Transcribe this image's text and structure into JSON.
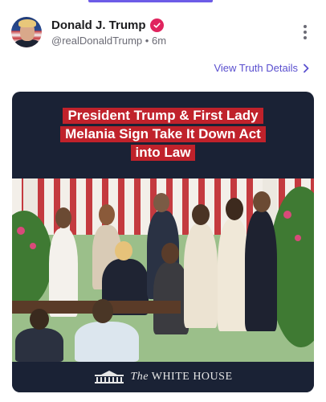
{
  "post": {
    "display_name": "Donald J. Trump",
    "handle": "@realDonaldTrump",
    "separator": "•",
    "time_ago": "6m",
    "view_details_label": "View Truth Details"
  },
  "media": {
    "headline_lines": [
      "President Trump & First Lady",
      "Melania Sign Take It Down Act",
      "into Law"
    ],
    "brand_prefix": "The",
    "brand_name": "WHITE HOUSE"
  },
  "colors": {
    "accent": "#6d5ce7",
    "link": "#5a4fcf",
    "verified": "#e0245e",
    "headline_bg": "#c0222b",
    "media_bg": "#1a2235"
  },
  "icons": {
    "verified": "verified-badge-icon",
    "more": "more-vertical-icon",
    "chevron": "chevron-right-icon",
    "brand": "white-house-logo-icon"
  }
}
